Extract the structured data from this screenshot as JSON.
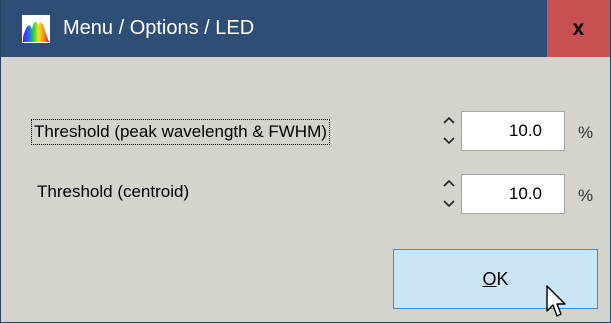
{
  "window": {
    "title": "Menu / Options / LED",
    "close_label": "x",
    "icon": "spectrum-app-icon"
  },
  "settings": [
    {
      "label": "Threshold (peak wavelength & FWHM)",
      "value": "10.0",
      "unit": "%",
      "focused": true
    },
    {
      "label": "Threshold (centroid)",
      "value": "10.0",
      "unit": "%",
      "focused": false
    }
  ],
  "buttons": {
    "ok_mnemonic": "O",
    "ok_rest": "K"
  },
  "colors": {
    "titlebar": "#2f4e75",
    "close_button": "#c75050",
    "dialog_background": "#d6d3cd",
    "ok_button_hover": "#c9e5f6",
    "ok_button_border": "#3c8fd0"
  }
}
